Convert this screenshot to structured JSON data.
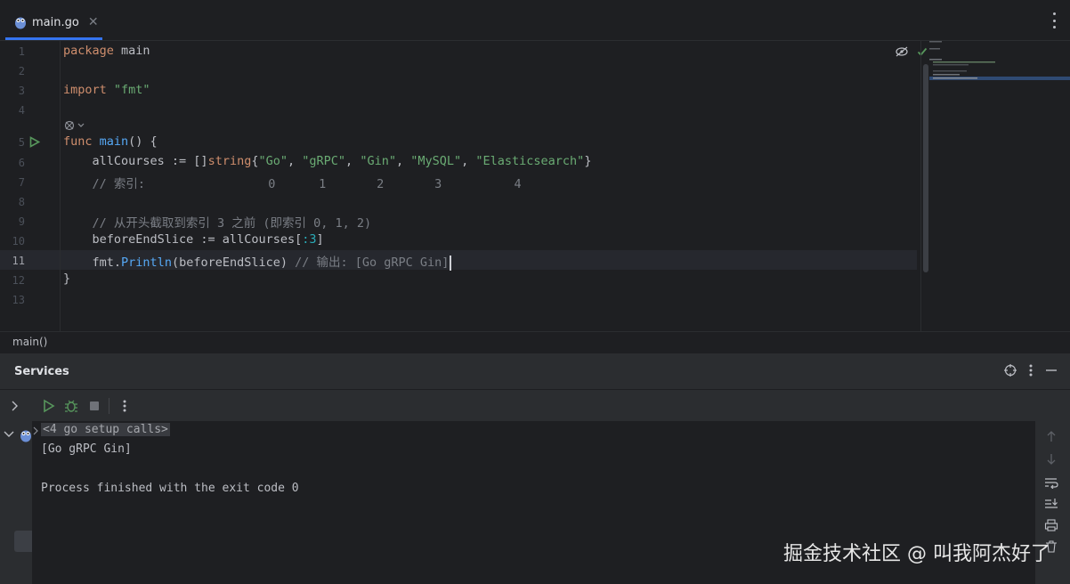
{
  "tab": {
    "filename": "main.go",
    "close": "✕"
  },
  "editor": {
    "line_numbers": [
      "1",
      "2",
      "3",
      "4",
      "5",
      "6",
      "7",
      "8",
      "9",
      "10",
      "11",
      "12",
      "13"
    ],
    "lines": {
      "l1_kw": "package",
      "l1_rest": " main",
      "l3_kw": "import",
      "l3_str": "\"fmt\"",
      "l5_kw": "func",
      "l5_fn": "main",
      "l5_rest": "() {",
      "l6_a": "    allCourses := []",
      "l6_typ": "string",
      "l6_b": "{",
      "l6_s1": "\"Go\"",
      "l6_s2": "\"gRPC\"",
      "l6_s3": "\"Gin\"",
      "l6_s4": "\"MySQL\"",
      "l6_s5": "\"Elasticsearch\"",
      "l6_c": "}",
      "l7": "    // 索引:                 0      1       2       3          4",
      "l9": "    // 从开头截取到索引 3 之前 (即索引 0, 1, 2)",
      "l10_a": "    beforeEndSlice := allCourses[",
      "l10_n": ":3",
      "l10_b": "]",
      "l11_pkg": "    fmt",
      "l11_dot": ".",
      "l11_fn": "Println",
      "l11_rest": "(beforeEndSlice) ",
      "l11_cm": "// 输出: [Go gRPC Gin]",
      "l12": "}"
    }
  },
  "breadcrumb": "main()",
  "services": {
    "title": "Services",
    "console": {
      "setup_calls": "<4 go setup calls>",
      "output": "[Go gRPC Gin]",
      "finished": "Process finished with the exit code 0"
    }
  },
  "watermark": "掘金技术社区 @ 叫我阿杰好了"
}
